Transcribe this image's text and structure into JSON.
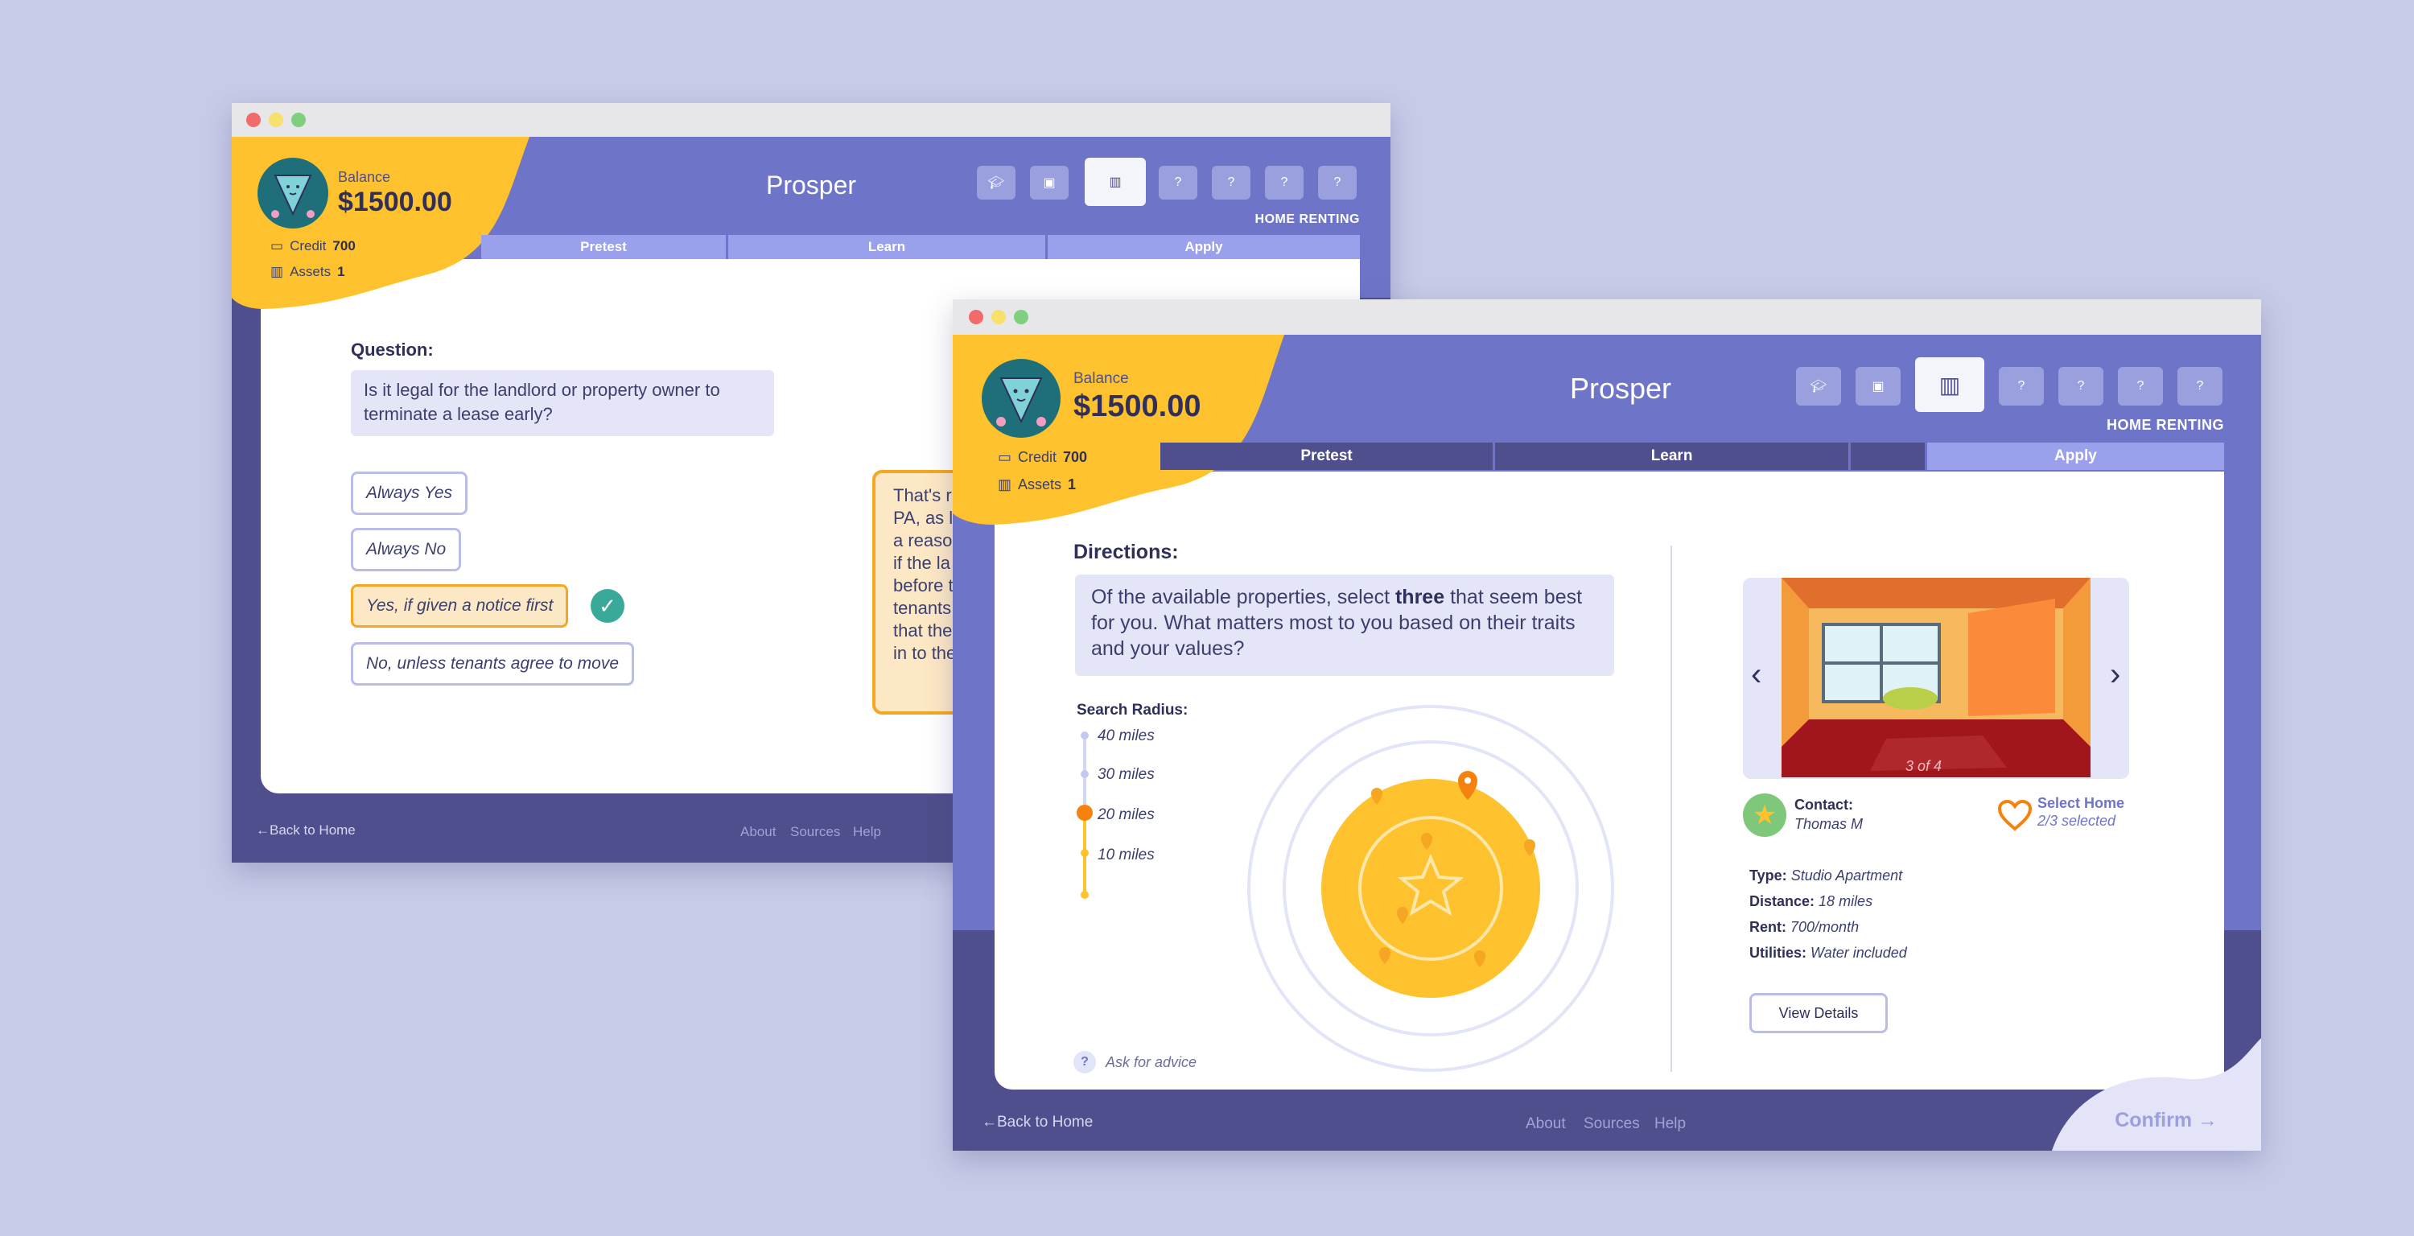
{
  "colors": {
    "background": "#c7cbe7",
    "header": "#6e74c7",
    "app_frame": "#4e4f8c",
    "accent_yellow": "#fec22f",
    "accent_orange": "#f5a623",
    "tab_active": "#9aa0ec",
    "check_green": "#3aa99a"
  },
  "common": {
    "app_title": "Prosper",
    "balance_label": "Balance",
    "balance_value": "$1500.00",
    "credit_label": "Credit",
    "credit_value": "700",
    "assets_label": "Assets",
    "assets_value": "1",
    "section_label": "HOME RENTING",
    "nav_icons": [
      "graduation-cap-icon",
      "briefcase-icon",
      "buildings-icon",
      "?",
      "?",
      "?",
      "?"
    ],
    "footer": {
      "back": "←Back to Home",
      "about": "About",
      "sources": "Sources",
      "help": "Help"
    }
  },
  "back_window": {
    "tabs": [
      "Pretest",
      "Learn",
      "Apply"
    ],
    "question_heading": "Question:",
    "question_text": "Is it legal for the landlord or property owner to terminate a lease early?",
    "options": [
      {
        "label": "Always Yes",
        "selected": false
      },
      {
        "label": "Always No",
        "selected": false
      },
      {
        "label": "Yes, if given a notice first",
        "selected": true
      },
      {
        "label": "No, unless tenants agree to move",
        "selected": false
      }
    ],
    "feedback_lines": [
      "That's r",
      "PA, as l",
      "a reaso",
      "if the la",
      "before t",
      "tenants",
      "that the",
      "in to the"
    ]
  },
  "front_window": {
    "tabs": [
      "Pretest",
      "Learn",
      "Apply"
    ],
    "active_tab": "Apply",
    "directions_heading": "Directions:",
    "directions_pre": "Of the available properties, select ",
    "directions_bold": "three",
    "directions_post": " that seem best for you. What matters most to you based on their traits and your values?",
    "search_radius_label": "Search Radius:",
    "radius_options": [
      "40 miles",
      "30 miles",
      "20 miles",
      "10 miles"
    ],
    "radius_selected": "20 miles",
    "ask_advice": "Ask for advice",
    "carousel": {
      "counter": "3 of 4",
      "prev": "‹",
      "next": "›"
    },
    "contact_label": "Contact:",
    "contact_name": "Thomas M",
    "select_home_label": "Select Home",
    "select_home_count": "2/3 selected",
    "details": [
      {
        "key": "Type:",
        "value": "Studio Apartment"
      },
      {
        "key": "Distance:",
        "value": "18 miles"
      },
      {
        "key": "Rent:",
        "value": "700/month"
      },
      {
        "key": "Utilities:",
        "value": "Water included"
      }
    ],
    "view_details": "View Details",
    "confirm": "Confirm →"
  }
}
